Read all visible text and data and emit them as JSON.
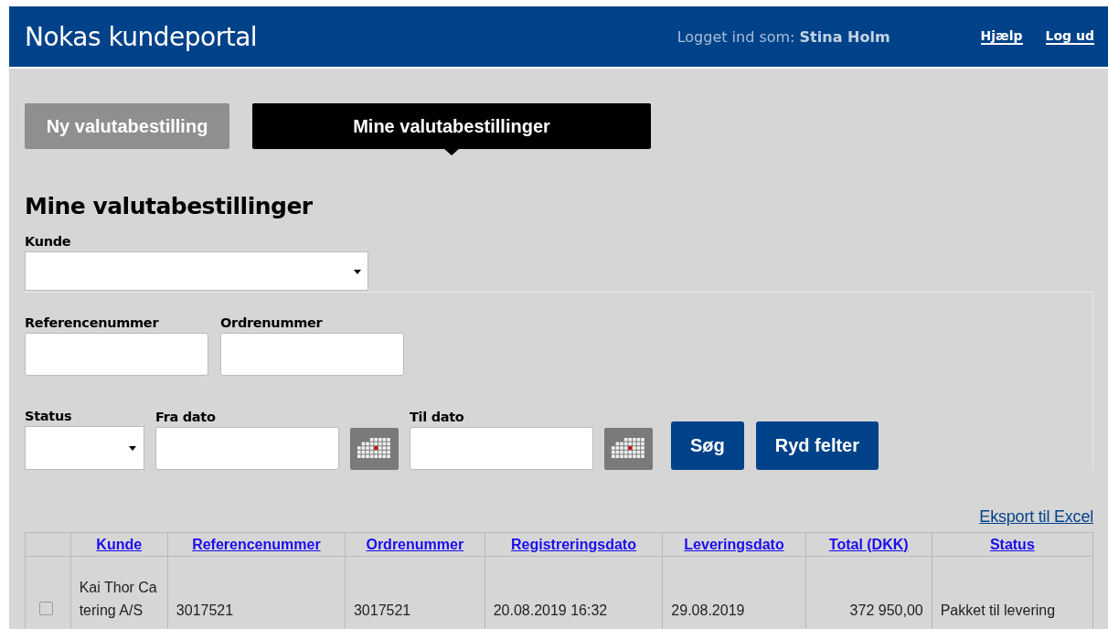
{
  "header": {
    "title": "Nokas kundeportal",
    "login": "Logget ind som: **Stina Holm**",
    "links": [
      "Hjælp",
      "Log ud"
    ]
  },
  "tabs": [
    {
      "label": "Ny valutabestilling",
      "selected": false
    },
    {
      "label": "Mine valutabestillinger",
      "selected": true
    }
  ],
  "heading": "Mine valutabestillinger",
  "form": {
    "customer_label": "Kunde",
    "reference_label": "Referencenummer",
    "order_label": "Ordrenummer",
    "status_label": "Status",
    "from_label": "Fra dato",
    "to_label": "Til dato",
    "buttons": [
      "Søg",
      "Ryd felter"
    ]
  },
  "export_link": "Eksport til Excel",
  "table": {
    "columns": [
      "Kunde",
      "Referencenummer",
      "Ordrenummer",
      "Registreringsdato",
      "Leveringsdato",
      "Total (DKK)",
      "Status"
    ],
    "rows": [
      {
        "checked": false,
        "cells": [
          "Kai Thor Catering A/S",
          "3017521",
          "3017521",
          "20.08.2019 16:32",
          "29.08.2019",
          "372 950,00",
          "Pakket til levering"
        ]
      }
    ]
  }
}
